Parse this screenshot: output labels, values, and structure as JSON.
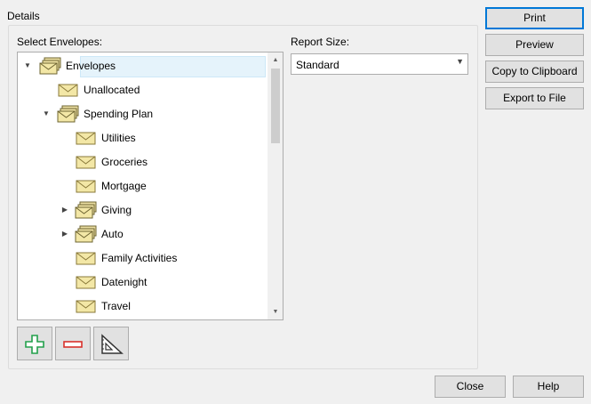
{
  "details": {
    "group_label": "Details",
    "select_envelopes_label": "Select Envelopes:",
    "report_size_label": "Report Size:"
  },
  "tree": {
    "items": [
      {
        "label": "Envelopes",
        "expand_state": "expanded",
        "icon": "multi-envelope-icon",
        "selected": true
      },
      {
        "label": "Unallocated",
        "expand_state": "none",
        "icon": "envelope-icon"
      },
      {
        "label": "Spending Plan",
        "expand_state": "expanded",
        "icon": "multi-envelope-icon"
      },
      {
        "label": "Utilities",
        "expand_state": "none",
        "icon": "envelope-icon"
      },
      {
        "label": "Groceries",
        "expand_state": "none",
        "icon": "envelope-icon"
      },
      {
        "label": "Mortgage",
        "expand_state": "none",
        "icon": "envelope-icon"
      },
      {
        "label": "Giving",
        "expand_state": "collapsed",
        "icon": "multi-envelope-icon"
      },
      {
        "label": "Auto",
        "expand_state": "collapsed",
        "icon": "multi-envelope-icon"
      },
      {
        "label": "Family Activities",
        "expand_state": "none",
        "icon": "envelope-icon"
      },
      {
        "label": "Datenight",
        "expand_state": "none",
        "icon": "envelope-icon"
      },
      {
        "label": "Travel",
        "expand_state": "none",
        "icon": "envelope-icon"
      }
    ]
  },
  "report_size": {
    "value": "Standard"
  },
  "tools": {
    "add_icon": "plus-icon",
    "remove_icon": "minus-icon",
    "settings_icon": "triangle-ruler-icon"
  },
  "buttons": {
    "print": "Print",
    "preview": "Preview",
    "copy": "Copy to Clipboard",
    "export": "Export to File",
    "close": "Close",
    "help": "Help"
  },
  "colors": {
    "add_green": "#22a04b",
    "remove_red": "#d9312b",
    "selection": "#e5f3fb",
    "default_button_border": "#0078d7"
  }
}
